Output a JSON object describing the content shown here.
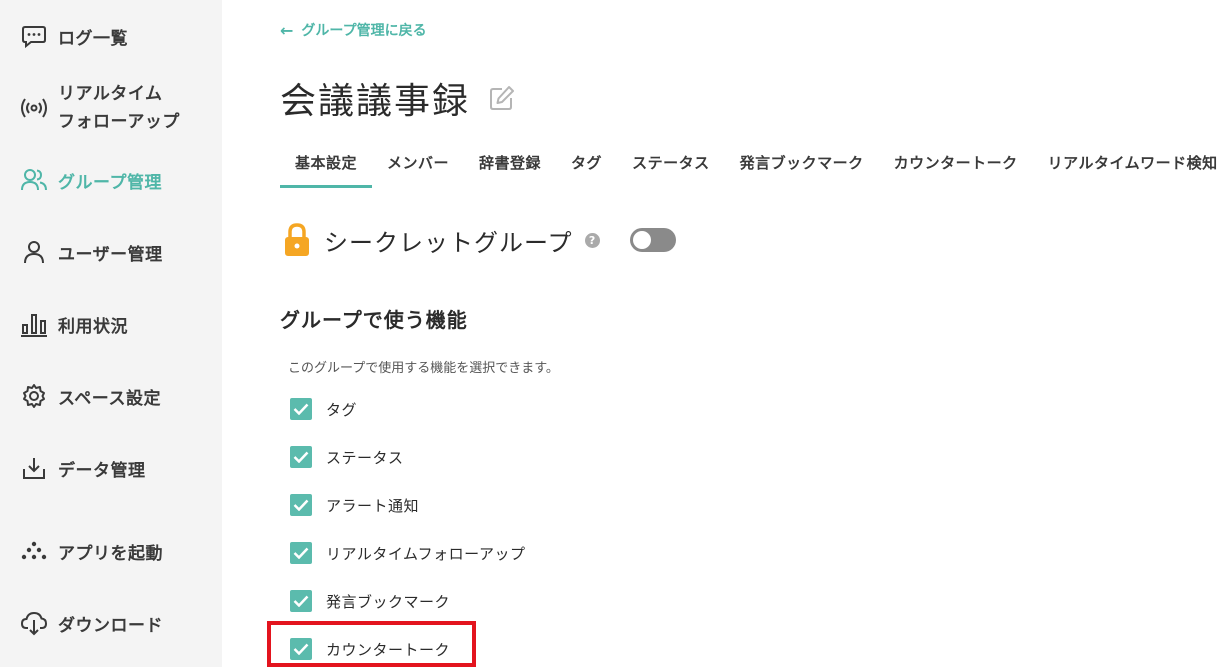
{
  "sidebar": {
    "items": [
      {
        "label": "ログ一覧",
        "icon": "chat-bubble-icon"
      },
      {
        "label_line1": "リアルタイム",
        "label_line2": "フォローアップ",
        "icon": "broadcast-icon"
      },
      {
        "label": "グループ管理",
        "icon": "group-icon",
        "active": true
      },
      {
        "label": "ユーザー管理",
        "icon": "user-icon"
      },
      {
        "label": "利用状況",
        "icon": "bar-chart-icon"
      },
      {
        "label": "スペース設定",
        "icon": "gear-icon"
      },
      {
        "label": "データ管理",
        "icon": "download-tray-icon"
      },
      {
        "label": "アプリを起動",
        "icon": "app-launch-icon"
      },
      {
        "label": "ダウンロード",
        "icon": "cloud-download-icon"
      }
    ]
  },
  "header": {
    "back_label": "グループ管理に戻る",
    "title": "会議議事録"
  },
  "tabs": [
    "基本設定",
    "メンバー",
    "辞書登録",
    "タグ",
    "ステータス",
    "発言ブックマーク",
    "カウンタートーク",
    "リアルタイムワード検知"
  ],
  "secret": {
    "label": "シークレットグループ",
    "help": "?",
    "enabled": false
  },
  "features": {
    "title": "グループで使う機能",
    "description": "このグループで使用する機能を選択できます。",
    "items": [
      {
        "label": "タグ",
        "checked": true
      },
      {
        "label": "ステータス",
        "checked": true
      },
      {
        "label": "アラート通知",
        "checked": true
      },
      {
        "label": "リアルタイムフォローアップ",
        "checked": true
      },
      {
        "label": "発言ブックマーク",
        "checked": true
      },
      {
        "label": "カウンタートーク",
        "checked": true
      }
    ]
  },
  "colors": {
    "accent": "#4fb6a8",
    "highlight": "#e3141e",
    "sidebar_bg": "#f4f4f4",
    "lock": "#f5a623"
  }
}
